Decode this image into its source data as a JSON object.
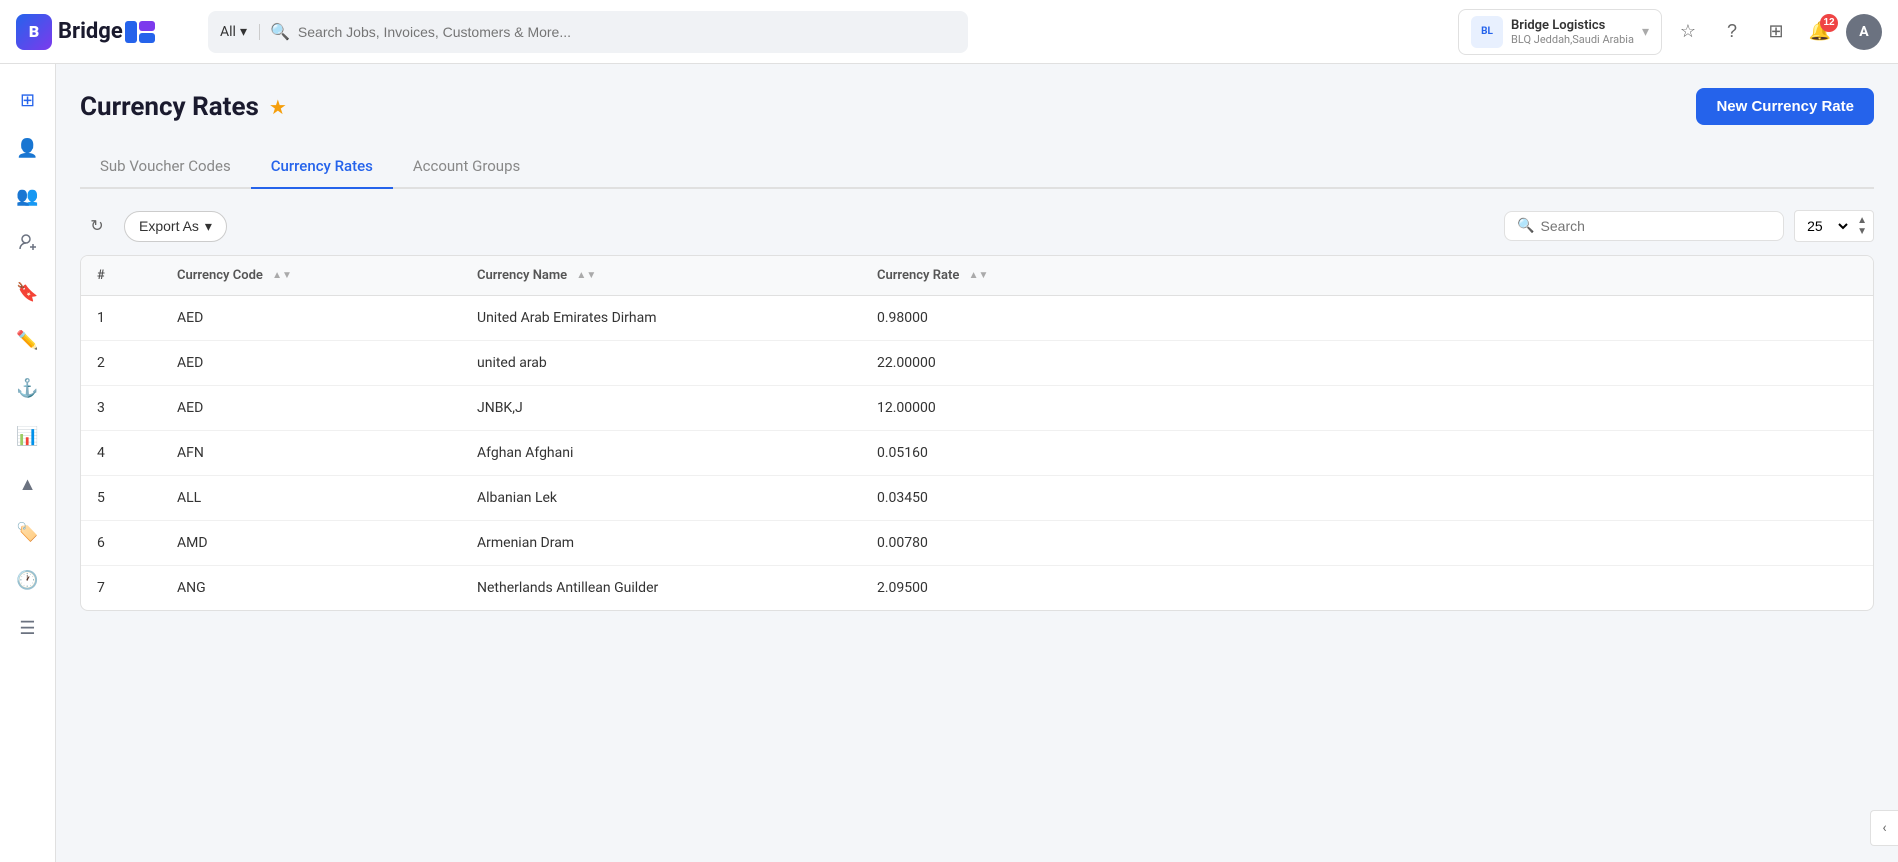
{
  "app": {
    "name": "Bridge",
    "logo_letter": "B"
  },
  "topnav": {
    "search_type": "All",
    "search_placeholder": "Search Jobs, Invoices, Customers & More...",
    "company": {
      "name": "Bridge Logistics",
      "location": "BLQ Jeddah,Saudi Arabia",
      "logo_abbr": "BL"
    },
    "notification_count": "12",
    "avatar_letter": "A"
  },
  "sidebar": {
    "items": [
      {
        "icon": "⊞",
        "name": "dashboard-icon"
      },
      {
        "icon": "👤",
        "name": "person-icon"
      },
      {
        "icon": "👥",
        "name": "people-icon"
      },
      {
        "icon": "➕",
        "name": "add-person-icon"
      },
      {
        "icon": "🔖",
        "name": "bookmark-icon"
      },
      {
        "icon": "✏️",
        "name": "edit-icon"
      },
      {
        "icon": "⚓",
        "name": "anchor-icon"
      },
      {
        "icon": "📊",
        "name": "chart-icon"
      },
      {
        "icon": "▲",
        "name": "triangle-icon"
      },
      {
        "icon": "🏷️",
        "name": "tag-icon"
      },
      {
        "icon": "🕐",
        "name": "clock-icon"
      },
      {
        "icon": "☰",
        "name": "list-icon"
      }
    ]
  },
  "page": {
    "title": "Currency Rates",
    "new_button_label": "New Currency Rate"
  },
  "tabs": [
    {
      "label": "Sub Voucher Codes",
      "active": false
    },
    {
      "label": "Currency Rates",
      "active": true
    },
    {
      "label": "Account Groups",
      "active": false
    }
  ],
  "toolbar": {
    "export_label": "Export As",
    "search_placeholder": "Search",
    "per_page_value": "25"
  },
  "table": {
    "columns": [
      {
        "label": "#",
        "sortable": false
      },
      {
        "label": "Currency Code",
        "sortable": true
      },
      {
        "label": "Currency Name",
        "sortable": true
      },
      {
        "label": "Currency Rate",
        "sortable": true
      }
    ],
    "rows": [
      {
        "num": "1",
        "code": "AED",
        "name": "United Arab Emirates Dirham",
        "rate": "0.98000"
      },
      {
        "num": "2",
        "code": "AED",
        "name": "united arab",
        "rate": "22.00000"
      },
      {
        "num": "3",
        "code": "AED",
        "name": "JNBK,J",
        "rate": "12.00000"
      },
      {
        "num": "4",
        "code": "AFN",
        "name": "Afghan Afghani",
        "rate": "0.05160"
      },
      {
        "num": "5",
        "code": "ALL",
        "name": "Albanian Lek",
        "rate": "0.03450"
      },
      {
        "num": "6",
        "code": "AMD",
        "name": "Armenian Dram",
        "rate": "0.00780"
      },
      {
        "num": "7",
        "code": "ANG",
        "name": "Netherlands Antillean Guilder",
        "rate": "2.09500"
      }
    ]
  }
}
